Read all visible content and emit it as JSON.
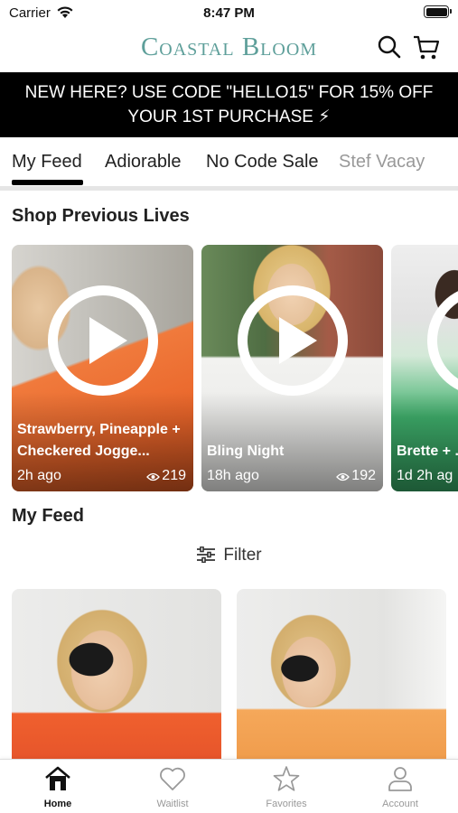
{
  "status_bar": {
    "carrier": "Carrier",
    "time": "8:47 PM"
  },
  "header": {
    "brand": "Coastal Bloom",
    "search_icon": "search-icon",
    "cart_icon": "cart-icon"
  },
  "promo": {
    "line1": "NEW HERE? USE CODE \"HELLO15\" FOR 15% OFF",
    "line2": "YOUR 1ST PURCHASE ⚡"
  },
  "tabs": [
    {
      "label": "My Feed",
      "active": true
    },
    {
      "label": "Adiorable",
      "active": false
    },
    {
      "label": "No Code Sale",
      "active": false
    },
    {
      "label": "Stef Vacay",
      "active": false
    }
  ],
  "previous_lives": {
    "title": "Shop Previous Lives",
    "items": [
      {
        "title": "Strawberry, Pineapple + Checkered Jogge...",
        "ago": "2h ago",
        "views": "219"
      },
      {
        "title": "Bling Night",
        "ago": "18h ago",
        "views": "192"
      },
      {
        "title": "Brette + ...",
        "ago": "1d 2h ag",
        "views": ""
      }
    ]
  },
  "feed": {
    "title": "My Feed",
    "filter_label": "Filter"
  },
  "bottom_nav": [
    {
      "label": "Home",
      "icon": "home-icon",
      "active": true
    },
    {
      "label": "Waitlist",
      "icon": "heart-icon",
      "active": false
    },
    {
      "label": "Favorites",
      "icon": "star-icon",
      "active": false
    },
    {
      "label": "Account",
      "icon": "account-icon",
      "active": false
    }
  ],
  "colors": {
    "brand": "#5e9f9a",
    "promo_bg": "#000000",
    "active_text": "#111111",
    "inactive_text": "#999999"
  }
}
